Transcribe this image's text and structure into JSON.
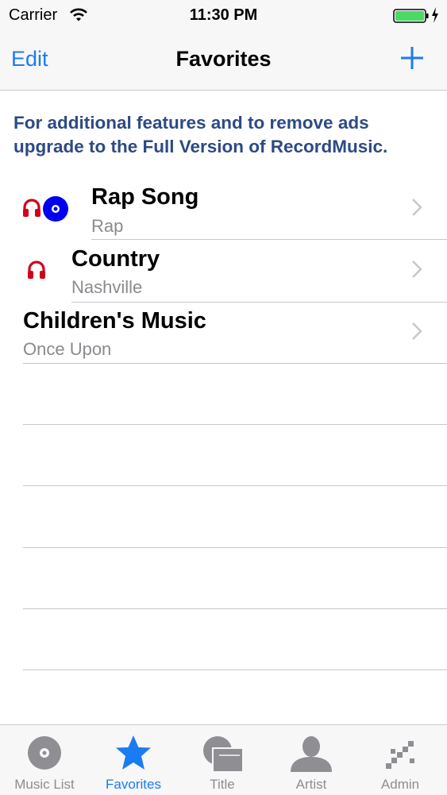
{
  "status_bar": {
    "carrier": "Carrier",
    "time": "11:30 PM"
  },
  "nav": {
    "edit_label": "Edit",
    "title": "Favorites",
    "add_icon": "plus-icon"
  },
  "banner": {
    "text": "For additional features and to remove ads upgrade to the Full Version of RecordMusic."
  },
  "rows": [
    {
      "title": "Rap Song",
      "subtitle": "Rap",
      "icons": [
        "headphones-icon",
        "disc-icon"
      ]
    },
    {
      "title": "Country",
      "subtitle": "Nashville",
      "icons": [
        "headphones-icon"
      ]
    },
    {
      "title": "Children's Music",
      "subtitle": "Once Upon",
      "icons": []
    }
  ],
  "tabs": [
    {
      "label": "Music List",
      "icon": "disc-icon"
    },
    {
      "label": "Favorites",
      "icon": "star-icon",
      "active": true
    },
    {
      "label": "Title",
      "icon": "title-icon"
    },
    {
      "label": "Artist",
      "icon": "person-icon"
    },
    {
      "label": "Admin",
      "icon": "admin-icon"
    }
  ],
  "colors": {
    "accent": "#1a7cf2",
    "banner": "#2d4a84",
    "headphones": "#d0021b",
    "disc": "#0000ee",
    "battery": "#4cd964"
  }
}
